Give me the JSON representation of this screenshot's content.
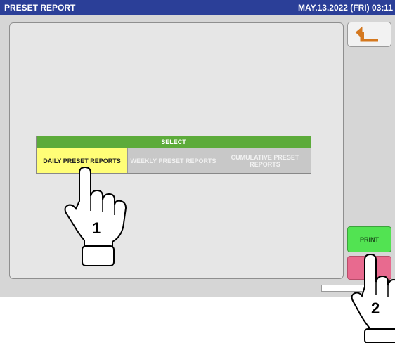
{
  "header": {
    "title": "PRESET REPORT",
    "datetime": "MAY.13.2022 (FRI) 03:11"
  },
  "select_panel": {
    "heading": "SELECT",
    "options": [
      {
        "label": "DAILY PRESET REPORTS",
        "selected": true
      },
      {
        "label": "WEEKLY PRESET REPORTS",
        "selected": false
      },
      {
        "label": "CUMULATIVE PRESET REPORTS",
        "selected": false
      }
    ]
  },
  "buttons": {
    "back_icon": "return-arrow-icon",
    "print_label": "PRINT",
    "second_label": ""
  },
  "callouts": {
    "step1": "1",
    "step2": "2"
  },
  "colors": {
    "title_bar": "#2b3f98",
    "select_header": "#5cab3a",
    "selected_option": "#fffe77",
    "print": "#52e352",
    "secondary": "#e86a8f"
  }
}
